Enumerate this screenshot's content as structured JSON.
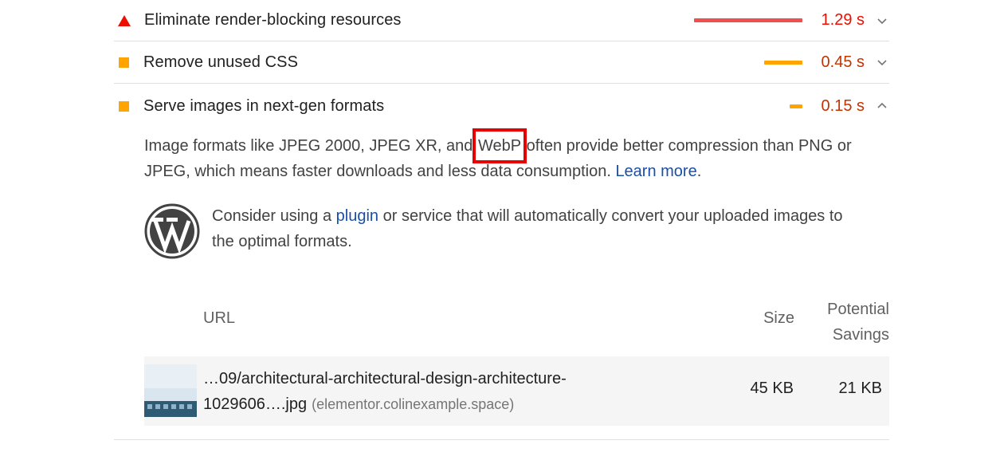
{
  "audits": [
    {
      "title": "Eliminate render-blocking resources",
      "savings": "1.29 s",
      "severity": "fail",
      "bar_fraction": 1.0,
      "color": "#eb0f00"
    },
    {
      "title": "Remove unused CSS",
      "savings": "0.45 s",
      "severity": "average",
      "bar_fraction": 0.35,
      "color": "#c33300"
    },
    {
      "title": "Serve images in next-gen formats",
      "savings": "0.15 s",
      "severity": "average",
      "bar_fraction": 0.12,
      "color": "#c33300",
      "expanded": true
    }
  ],
  "details": {
    "desc_part1": "Image formats like JPEG 2000, JPEG XR, and ",
    "desc_highlight": "WebP",
    "desc_part2": " often provide better compression than PNG or JPEG, which means faster downloads and less data consumption. ",
    "learn_more": "Learn more",
    "desc_end": ".",
    "stack_part1": "Consider using a ",
    "stack_link": "plugin",
    "stack_part2": " or service that will automatically convert your uploaded images to the optimal formats."
  },
  "table": {
    "headers": {
      "url": "URL",
      "size": "Size",
      "savings_line1": "Potential",
      "savings_line2": "Savings"
    },
    "rows": [
      {
        "url_line1": "…09/architectural-architectural-design-architecture-",
        "url_line2": "1029606….jpg",
        "host": "(elementor.colinexample.space)",
        "size": "45 KB",
        "savings": "21 KB"
      }
    ]
  },
  "colors": {
    "fail": "#eb0f00",
    "average": "#ffa400",
    "link": "#1a4fa5",
    "highlight_box": "#e60000"
  },
  "icons": {
    "fail_marker": "triangle-icon",
    "average_marker": "square-icon",
    "expand": "chevron-down-icon",
    "collapse": "chevron-up-icon",
    "stack_logo": "wordpress-logo-icon"
  }
}
